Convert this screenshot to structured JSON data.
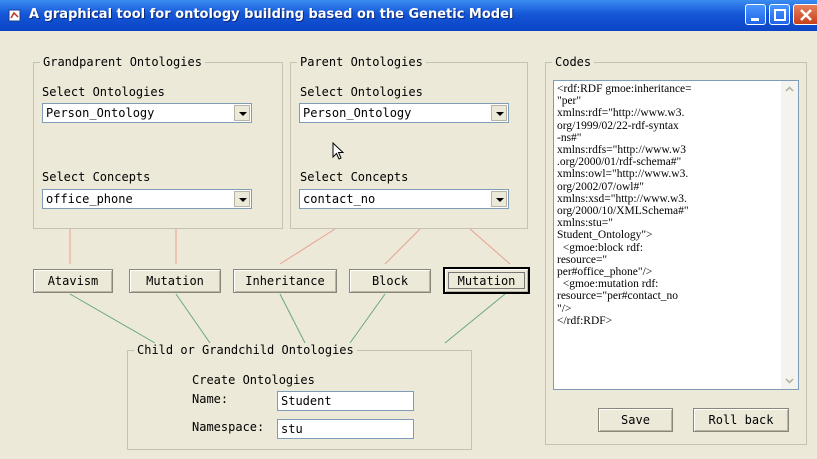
{
  "window": {
    "title": "A graphical tool for ontology building based on the Genetic Model"
  },
  "grandparent": {
    "legend": "Grandparent Ontologies",
    "select_ontologies_label": "Select Ontologies",
    "ontology_value": "Person_Ontology",
    "select_concepts_label": "Select Concepts",
    "concept_value": "office_phone"
  },
  "parent": {
    "legend": "Parent Ontologies",
    "select_ontologies_label": "Select Ontologies",
    "ontology_value": "Person_Ontology",
    "select_concepts_label": "Select Concepts",
    "concept_value": "contact_no"
  },
  "operations": {
    "atavism": "Atavism",
    "mutation1": "Mutation",
    "inheritance": "Inheritance",
    "block": "Block",
    "mutation2": "Mutation"
  },
  "child": {
    "legend": "Child or Grandchild Ontologies",
    "create_label": "Create Ontologies",
    "name_label": "Name:",
    "name_value": "Student",
    "namespace_label": "Namespace:",
    "namespace_value": "stu"
  },
  "codes": {
    "legend": "Codes",
    "text": "<rdf:RDF gmoe:inheritance=\n\"per\"\nxmlns:rdf=\"http://www.w3.\norg/1999/02/22-rdf-syntax\n-ns#\"\nxmlns:rdfs=\"http://www.w3\n.org/2000/01/rdf-schema#\"\nxmlns:owl=\"http://www.w3.\norg/2002/07/owl#\"\nxmlns:xsd=\"http://www.w3.\norg/2000/10/XMLSchema#\"\nxmlns:stu=\"\nStudent_Ontology\">\n  <gmoe:block rdf:\nresource=\"\nper#office_phone\"/>\n  <gmoe:mutation rdf:\nresource=\"per#contact_no\n\"/>\n</rdf:RDF>",
    "save_label": "Save",
    "rollback_label": "Roll back"
  }
}
